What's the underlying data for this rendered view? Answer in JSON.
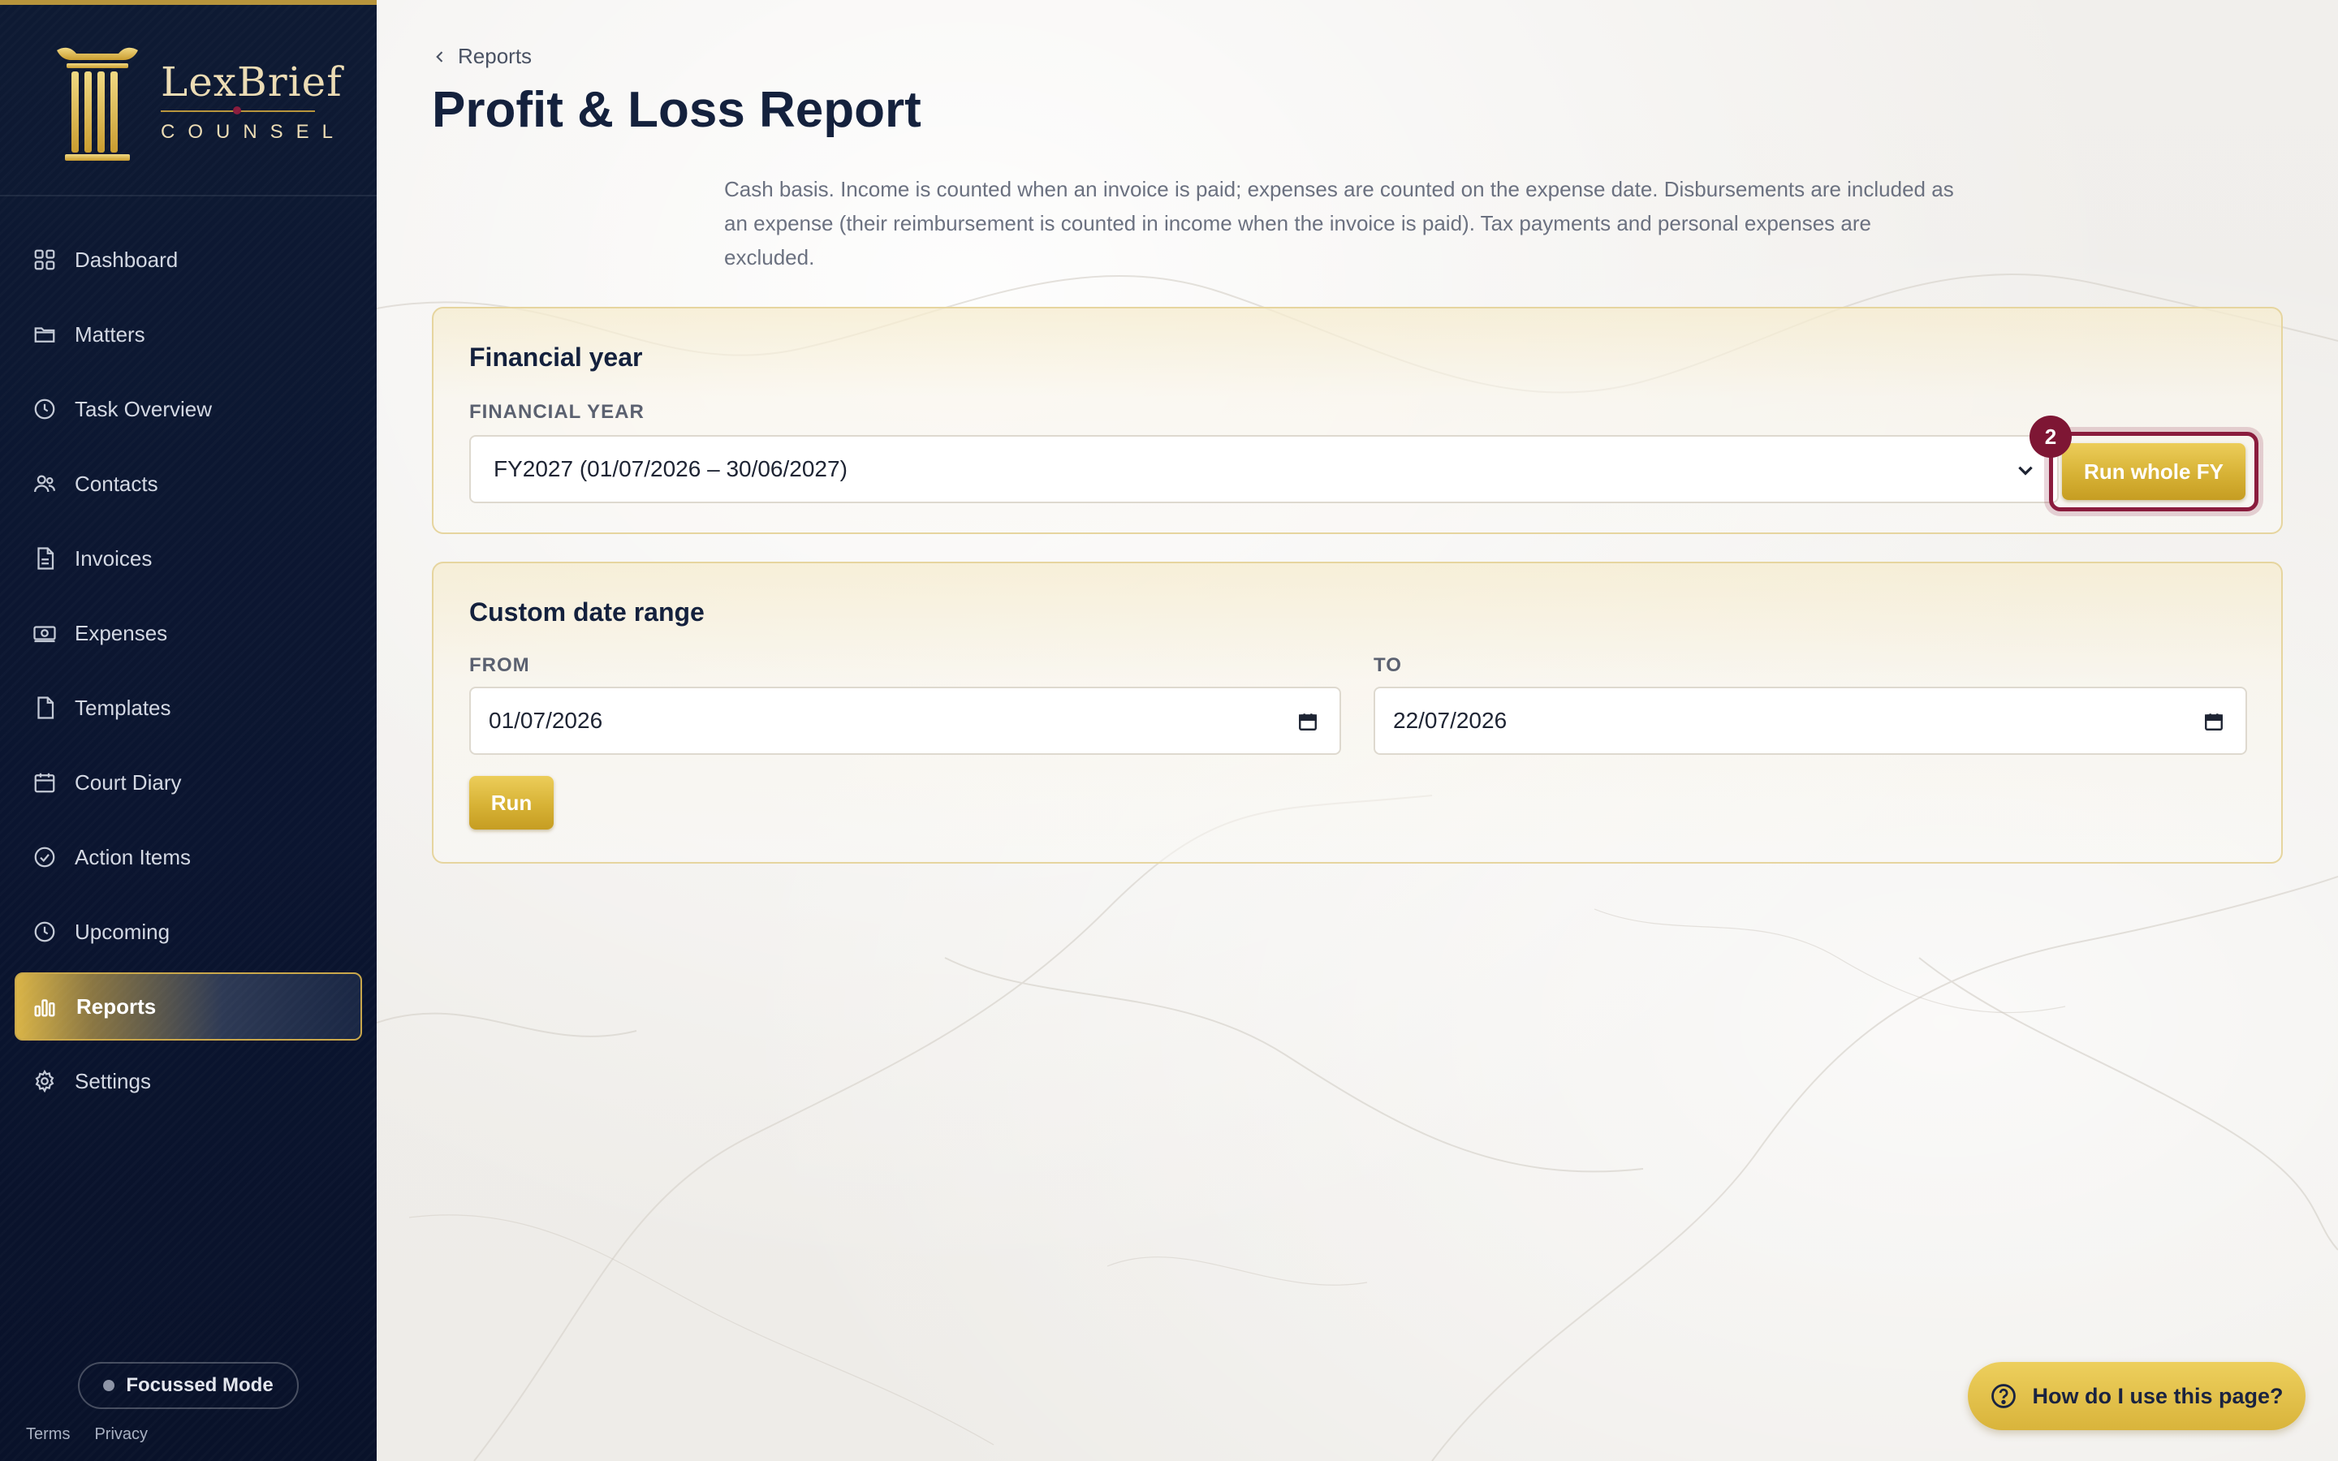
{
  "brand": {
    "name": "LexBrief",
    "subtitle": "COUNSEL"
  },
  "sidebar": {
    "items": [
      {
        "label": "Dashboard",
        "icon": "grid-icon"
      },
      {
        "label": "Matters",
        "icon": "folder-icon"
      },
      {
        "label": "Task Overview",
        "icon": "clock-icon"
      },
      {
        "label": "Contacts",
        "icon": "users-icon"
      },
      {
        "label": "Invoices",
        "icon": "invoice-icon"
      },
      {
        "label": "Expenses",
        "icon": "banknote-icon"
      },
      {
        "label": "Templates",
        "icon": "document-icon"
      },
      {
        "label": "Court Diary",
        "icon": "calendar-icon"
      },
      {
        "label": "Action Items",
        "icon": "check-circle-icon"
      },
      {
        "label": "Upcoming",
        "icon": "clock-icon"
      },
      {
        "label": "Reports",
        "icon": "bar-chart-icon",
        "active": true
      },
      {
        "label": "Settings",
        "icon": "gear-icon"
      }
    ],
    "focus_mode": "Focussed Mode",
    "terms": "Terms",
    "privacy": "Privacy"
  },
  "header": {
    "breadcrumb": "Reports",
    "title": "Profit & Loss Report",
    "description": "Cash basis. Income is counted when an invoice is paid; expenses are counted on the expense date. Disbursements are included as an expense (their reimbursement is counted in income when the invoice is paid). Tax payments and personal expenses are excluded."
  },
  "financial_year": {
    "heading": "Financial year",
    "field_label": "FINANCIAL YEAR",
    "selected": "FY2027 (01/07/2026 – 30/06/2027)",
    "run_label": "Run whole FY",
    "badge": "2"
  },
  "custom_range": {
    "heading": "Custom date range",
    "from_label": "FROM",
    "from_value": "01/07/2026",
    "to_label": "TO",
    "to_value": "22/07/2026",
    "run_label": "Run"
  },
  "help": {
    "label": "How do I use this page?"
  },
  "colors": {
    "sidebar": "#0e1a33",
    "gold": "#d7b235",
    "maroon": "#8a1c3d",
    "title": "#14213d"
  }
}
